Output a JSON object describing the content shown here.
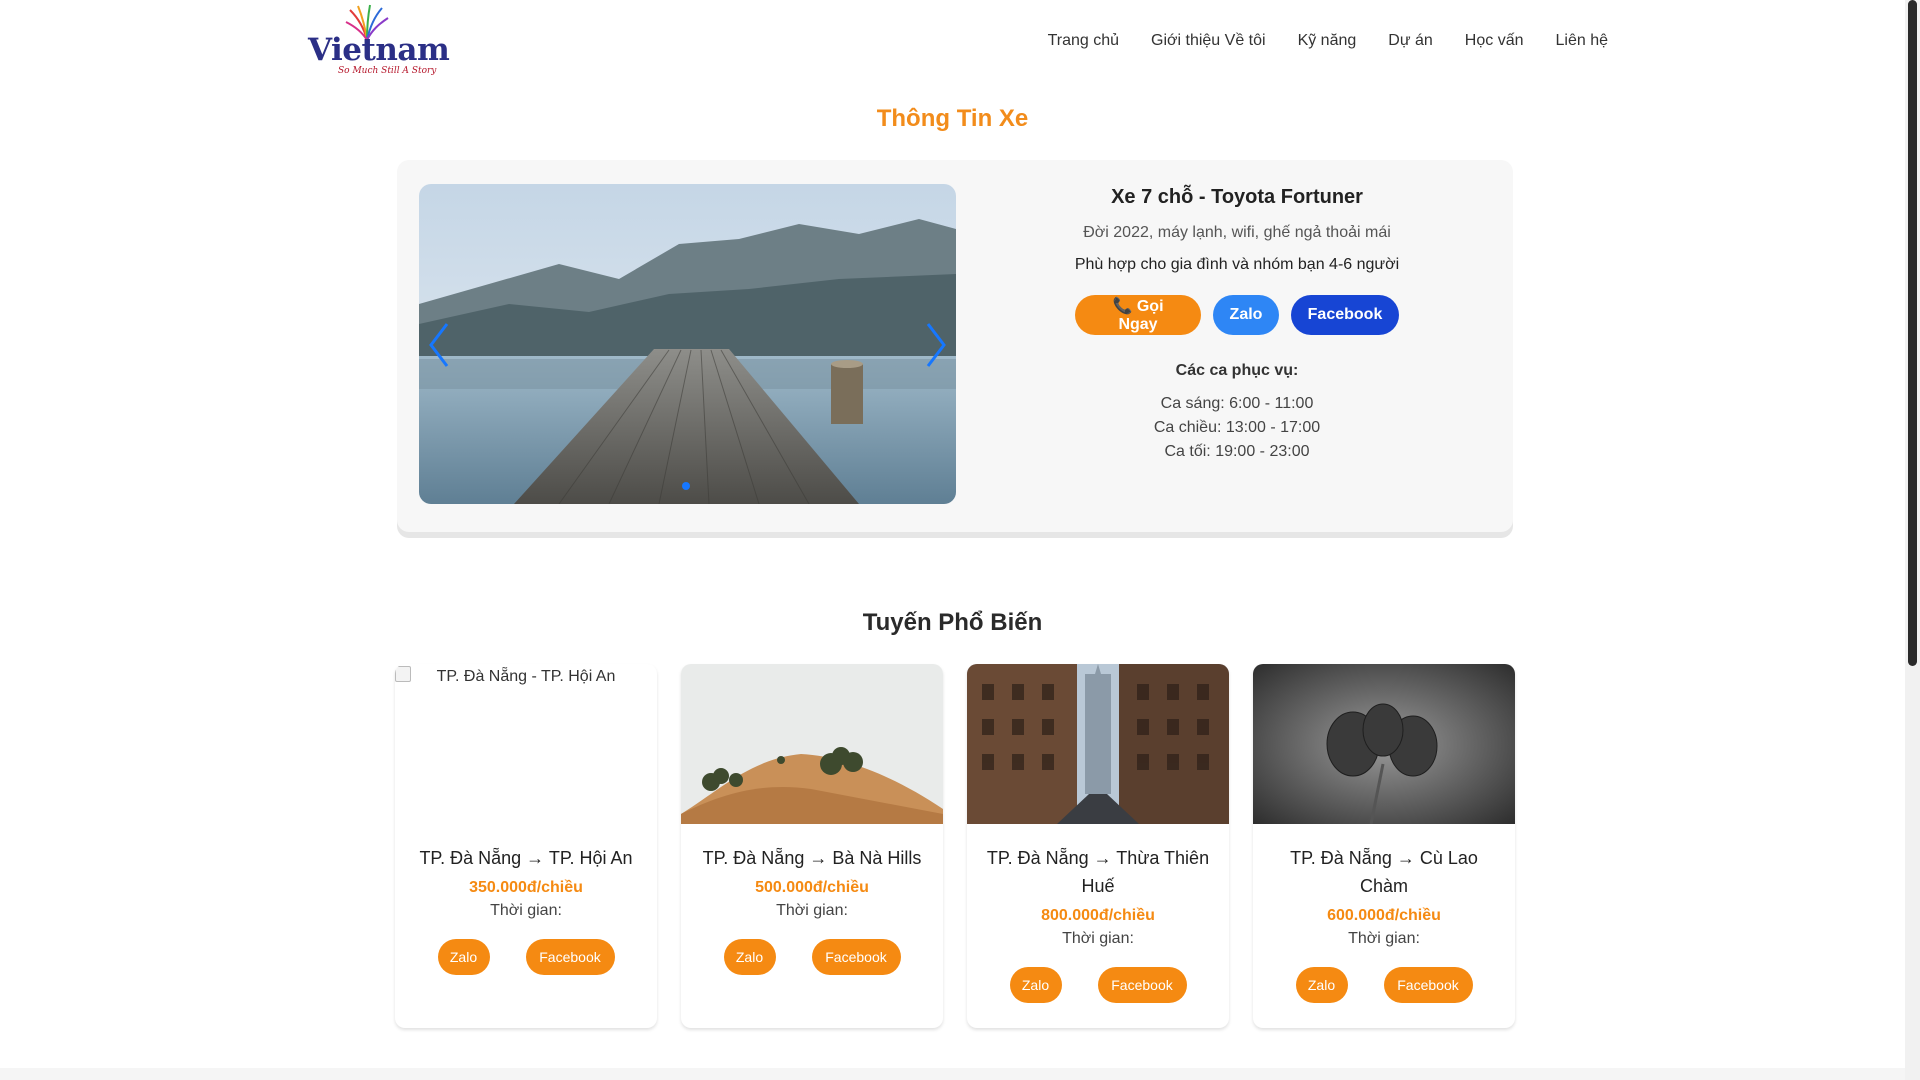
{
  "header": {
    "logo_text": "Vietnam",
    "logo_tagline": "So Much Still A Story",
    "nav": [
      "Trang chủ",
      "Giới thiệu Về tôi",
      "Kỹ năng",
      "Dự án",
      "Học vấn",
      "Liên hệ"
    ]
  },
  "vehicle_section": {
    "title": "Thông Tin Xe",
    "name": "Xe 7 chỗ - Toyota Fortuner",
    "description": "Đời 2022, máy lạnh, wifi, ghế ngả thoải mái",
    "suitability": "Phù hợp cho gia đình và nhóm bạn 4-6 người",
    "buttons": {
      "call": "📞 Gọi Ngay",
      "zalo": "Zalo",
      "facebook": "Facebook"
    },
    "shifts_title": "Các ca phục vụ:",
    "shifts": [
      "Ca sáng: 6:00 - 11:00",
      "Ca chiều: 13:00 - 17:00",
      "Ca tối: 19:00 - 23:00"
    ]
  },
  "routes_section": {
    "title": "Tuyến Phổ Biến",
    "routes": [
      {
        "name": "TP. Đà Nẵng → TP. Hội An",
        "image_alt": "TP. Đà Nẵng - TP. Hội An",
        "price": "350.000đ/chiều",
        "time": "Thời gian:",
        "zalo": "Zalo",
        "facebook": "Facebook"
      },
      {
        "name": "TP. Đà Nẵng → Bà Nà Hills",
        "price": "500.000đ/chiều",
        "time": "Thời gian:",
        "zalo": "Zalo",
        "facebook": "Facebook"
      },
      {
        "name": "TP. Đà Nẵng → Thừa Thiên Huế",
        "price": "800.000đ/chiều",
        "time": "Thời gian:",
        "zalo": "Zalo",
        "facebook": "Facebook"
      },
      {
        "name": "TP. Đà Nẵng → Cù Lao Chàm",
        "price": "600.000đ/chiều",
        "time": "Thời gian:",
        "zalo": "Zalo",
        "facebook": "Facebook"
      }
    ]
  },
  "colors": {
    "accent": "#f58a12",
    "zalo": "#2e86f5",
    "facebook": "#1745d4",
    "brand": "#2b2f86"
  },
  "icons": [
    "phone-icon",
    "chevron-left-icon",
    "chevron-right-icon",
    "broken-image-icon"
  ]
}
